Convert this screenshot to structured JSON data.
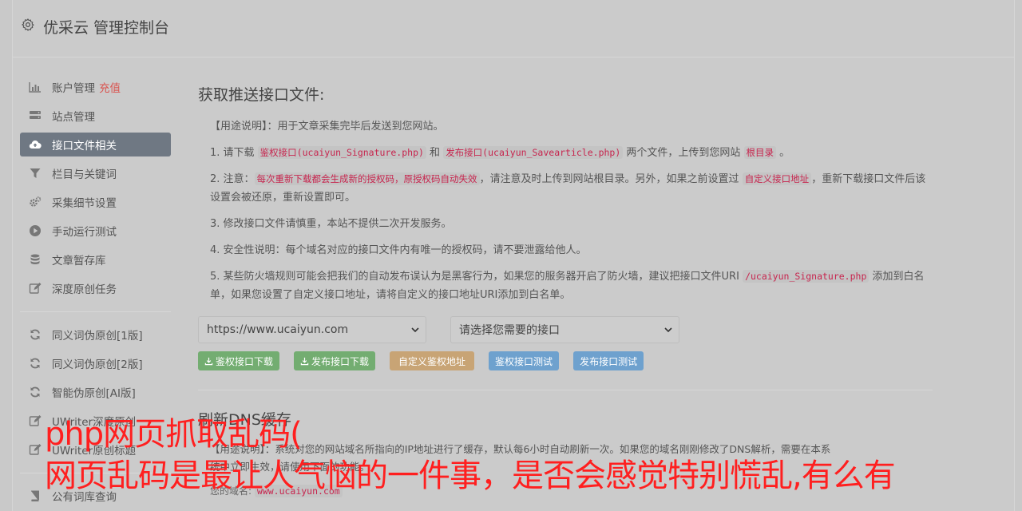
{
  "header": {
    "title": "优采云 管理控制台",
    "icon": "gear-icon"
  },
  "sidebar": {
    "items": [
      {
        "label": "账户管理",
        "extra": "充值",
        "icon": "bar-chart-icon",
        "active": false
      },
      {
        "label": "站点管理",
        "icon": "server-icon",
        "active": false
      },
      {
        "label": "接口文件相关",
        "icon": "cloud-upload-icon",
        "active": true
      },
      {
        "label": "栏目与关键词",
        "icon": "filter-icon",
        "active": false
      },
      {
        "label": "采集细节设置",
        "icon": "cogs-icon",
        "active": false
      },
      {
        "label": "手动运行测试",
        "icon": "play-circle-icon",
        "active": false
      },
      {
        "label": "文章暂存库",
        "icon": "database-icon",
        "active": false
      },
      {
        "label": "深度原创任务",
        "icon": "edit-icon",
        "active": false
      }
    ],
    "items2": [
      {
        "label": "同义词伪原创[1版]",
        "icon": "refresh-icon"
      },
      {
        "label": "同义词伪原创[2版]",
        "icon": "refresh-icon"
      },
      {
        "label": "智能伪原创[AI版]",
        "icon": "refresh-icon"
      },
      {
        "label": "UWriter深度原创",
        "icon": "edit-icon"
      },
      {
        "label": "UWriter原创标题",
        "icon": "edit-icon"
      }
    ],
    "items3": [
      {
        "label": "公有词库查询",
        "icon": "book-icon"
      }
    ]
  },
  "main": {
    "title": "获取推送接口文件:",
    "usage": "【用途说明】：用于文章采集完毕后发送到您网站。",
    "p1": {
      "a": "1. 请下载 ",
      "code1": "鉴权接口(ucaiyun_Signature.php)",
      "b": " 和 ",
      "code2": "发布接口(ucaiyun_Savearticle.php)",
      "c": " 两个文件，上传到您网站 ",
      "code3": "根目录",
      "d": " 。"
    },
    "p2": {
      "a": "2. 注意：",
      "code1": "每次重新下载都会生成新的授权码，原授权码自动失效",
      "b": "，请注意及时上传到网站根目录。另外，如果之前设置过 ",
      "code2": "自定义接口地址",
      "c": "，重新下载接口文件后该设置会被还原，重新设置即可。"
    },
    "p3": "3. 修改接口文件请慎重，本站不提供二次开发服务。",
    "p4": "4. 安全性说明：每个域名对应的接口文件内有唯一的授权码，请不要泄露给他人。",
    "p5": {
      "a": "5. 某些防火墙规则可能会把我们的自动发布误认为是黑客行为，如果您的服务器开启了防火墙，建议把接口文件URI ",
      "code1": "/ucaiyun_Signature.php",
      "b": " 添加到白名单，如果您设置了自定义接口地址，请将自定义的接口地址URI添加到白名单。"
    },
    "site_select": "https://www.ucaiyun.com",
    "api_select": "请选择您需要的接口",
    "buttons": {
      "sig_download": "鉴权接口下载",
      "pub_download": "发布接口下载",
      "custom_sig": "自定义鉴权地址",
      "sig_test": "鉴权接口测试",
      "pub_test": "发布接口测试"
    },
    "section2_title": "刷新DNS缓存",
    "usage2_a": "【用途说明】：系统对您的网站域名所指向的IP地址进行了缓存，默认每6小时自动刷新一次。如果您的域名刚刚修改了DNS解析，需要在本系",
    "usage2_b": "统中立即生效，请使用下面的功能。",
    "domain_label": "您的域名:",
    "domain_value": "www.ucaiyun.com"
  },
  "overlay": {
    "line1": "php网页抓取乱码(",
    "line2": "网页乱码是最让人气恼的一件事，是否会感觉特别慌乱,有么有"
  },
  "colors": {
    "accent_red": "#ff1f1f",
    "active_bg": "#6f7883",
    "green": "#73ad71",
    "orange": "#c8a475",
    "blue": "#6ea1ce",
    "code_red": "#c7254e"
  }
}
